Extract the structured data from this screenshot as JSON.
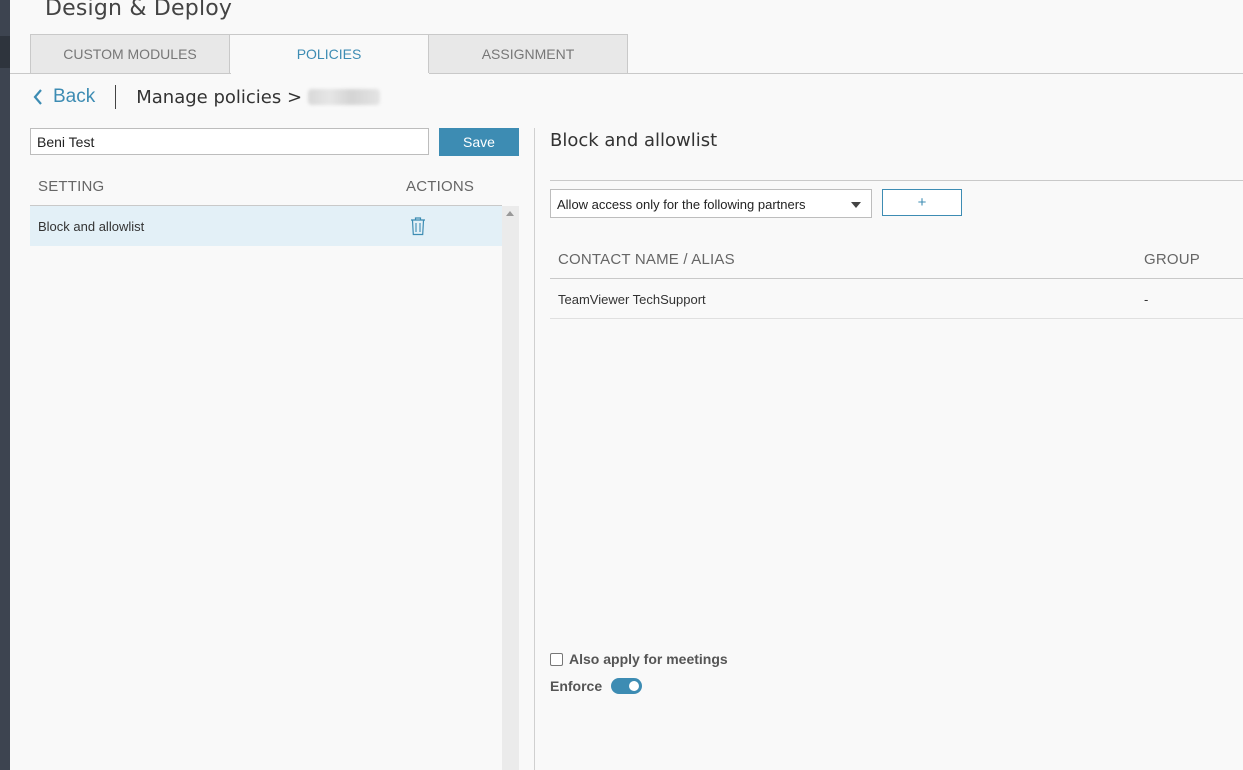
{
  "app": {
    "title": "Design & Deploy"
  },
  "tabs": [
    {
      "label": "CUSTOM MODULES",
      "active": false
    },
    {
      "label": "POLICIES",
      "active": true
    },
    {
      "label": "ASSIGNMENT",
      "active": false
    }
  ],
  "breadcrumb": {
    "back_label": "Back",
    "path": "Manage policies >"
  },
  "policy": {
    "name_value": "Beni Test",
    "save_label": "Save"
  },
  "settings_table": {
    "headers": {
      "setting": "SETTING",
      "actions": "ACTIONS"
    },
    "rows": [
      {
        "label": "Block and allowlist",
        "selected": true,
        "action_icon": "trash-icon"
      }
    ]
  },
  "detail": {
    "title": "Block and allowlist",
    "access_mode": {
      "selected": "Allow access only for the following partners"
    },
    "add_button_label": "+",
    "contacts": {
      "headers": {
        "name": "CONTACT NAME / ALIAS",
        "group": "GROUP"
      },
      "rows": [
        {
          "name": "TeamViewer TechSupport",
          "group": "-"
        }
      ]
    },
    "apply_meetings": {
      "label": "Also apply for meetings",
      "checked": false
    },
    "enforce": {
      "label": "Enforce",
      "on": true
    }
  },
  "colors": {
    "accent": "#3d8cb3",
    "selected_row": "#e3f0f7",
    "sidebar_strip": "#3d4450"
  }
}
